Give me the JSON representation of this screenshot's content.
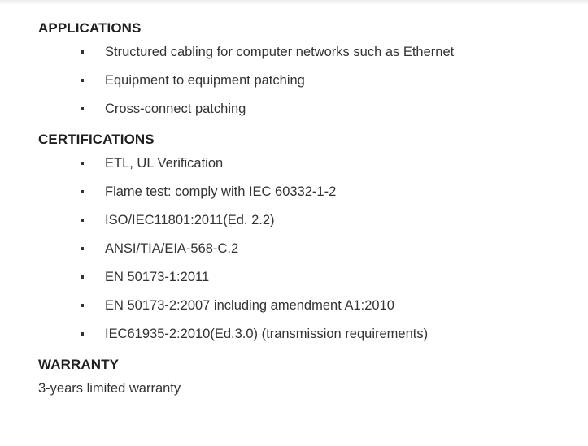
{
  "applications": {
    "heading": "APPLICATIONS",
    "items": [
      "Structured cabling for computer networks such as Ethernet",
      "Equipment to equipment patching",
      "Cross-connect patching"
    ]
  },
  "certifications": {
    "heading": "CERTIFICATIONS",
    "items": [
      "ETL, UL Verification",
      "Flame test: comply with IEC 60332-1-2",
      "ISO/IEC11801:2011(Ed. 2.2)",
      "ANSI/TIA/EIA-568-C.2",
      "EN 50173-1:2011",
      "EN 50173-2:2007 including amendment A1:2010",
      "IEC61935-2:2010(Ed.3.0) (transmission requirements)"
    ]
  },
  "warranty": {
    "heading": "WARRANTY",
    "text": "3-years limited warranty"
  }
}
